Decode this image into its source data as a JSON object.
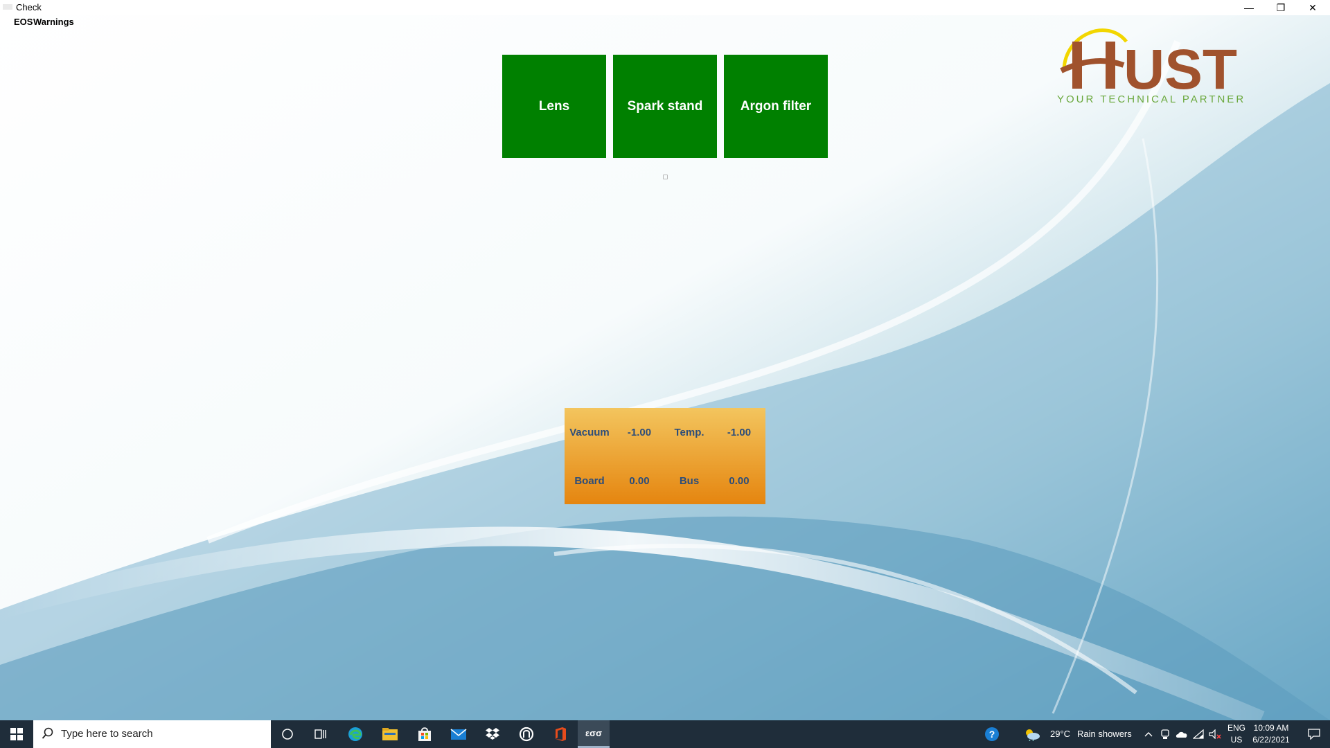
{
  "window": {
    "title": "Check",
    "controls": {
      "minimize": "—",
      "maximize": "❐",
      "close": "✕"
    }
  },
  "menu": {
    "items": [
      "EOS",
      "Warnings"
    ]
  },
  "logo": {
    "brand": "UST",
    "tagline": "YOUR TECHNICAL PARTNER",
    "colors": {
      "brand": "#a0522d",
      "tagline": "#6aa83c",
      "swoosh": "#f2d600"
    }
  },
  "tiles": [
    {
      "label": "Lens"
    },
    {
      "label": "Spark stand"
    },
    {
      "label": "Argon filter"
    }
  ],
  "tile_color": "#008000",
  "sensors": {
    "vacuum_label": "Vacuum",
    "vacuum_value": "-1.00",
    "temp_label": "Temp.",
    "temp_value": "-1.00",
    "board_label": "Board",
    "board_value": "0.00",
    "bus_label": "Bus",
    "bus_value": "0.00"
  },
  "taskbar": {
    "search_placeholder": "Type here to search",
    "active_app_label": "εσσ",
    "weather": {
      "temp": "29°C",
      "condition": "Rain showers"
    },
    "language": {
      "line1": "ENG",
      "line2": "US"
    },
    "clock": {
      "time": "10:09 AM",
      "date": "6/22/2021"
    },
    "icons": [
      "windows-start-icon",
      "cortana-icon",
      "task-view-icon",
      "edge-icon",
      "file-explorer-icon",
      "store-icon",
      "mail-icon",
      "dropbox-icon",
      "app-icon",
      "office-icon",
      "help-icon",
      "weather-icon",
      "chevron-up-icon",
      "meet-now-icon",
      "onedrive-icon",
      "network-icon",
      "volume-muted-icon",
      "notification-icon"
    ]
  }
}
